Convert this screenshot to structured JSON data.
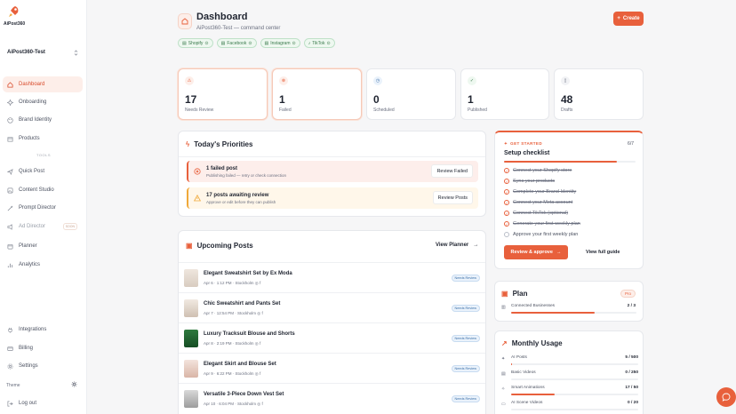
{
  "brand": {
    "logo_text": "AiPost360",
    "accent": "#e8603c"
  },
  "workspace": {
    "name": "AiPost360-Test"
  },
  "sidebar": {
    "items": [
      {
        "label": "Dashboard",
        "icon": "home-icon",
        "active": true
      },
      {
        "label": "Onboarding",
        "icon": "sparkle-icon"
      },
      {
        "label": "Brand Identity",
        "icon": "palette-icon"
      },
      {
        "label": "Products",
        "icon": "box-icon"
      }
    ],
    "tools_label": "TOOLS",
    "tools": [
      {
        "label": "Quick Post",
        "icon": "send-icon"
      },
      {
        "label": "Content Studio",
        "icon": "image-icon"
      },
      {
        "label": "Prompt Director",
        "icon": "wand-icon"
      },
      {
        "label": "Ad Director",
        "icon": "megaphone-icon",
        "badge": "SOON"
      },
      {
        "label": "Planner",
        "icon": "calendar-icon"
      },
      {
        "label": "Analytics",
        "icon": "chart-icon"
      }
    ],
    "bottom": [
      {
        "label": "Integrations",
        "icon": "plug-icon"
      },
      {
        "label": "Billing",
        "icon": "card-icon"
      },
      {
        "label": "Settings",
        "icon": "gear-icon"
      }
    ],
    "theme_label": "Theme",
    "logout_label": "Log out"
  },
  "header": {
    "title": "Dashboard",
    "subtitle": "AiPost360-Test — command center",
    "create_label": "Create",
    "tags": [
      "Shopify",
      "Facebook",
      "Instagram",
      "TikTok"
    ]
  },
  "stats": [
    {
      "value": "17",
      "label": "Needs Review"
    },
    {
      "value": "1",
      "label": "Failed"
    },
    {
      "value": "0",
      "label": "Scheduled"
    },
    {
      "value": "1",
      "label": "Published"
    },
    {
      "value": "48",
      "label": "Drafts"
    }
  ],
  "priorities": {
    "title": "Today's Priorities",
    "items": [
      {
        "title": "1 failed post",
        "subtitle": "Publishing failed — retry or check connection",
        "button": "Review Failed"
      },
      {
        "title": "17 posts awaiting review",
        "subtitle": "Approve or edit before they can publish",
        "button": "Review Posts"
      }
    ]
  },
  "upcoming": {
    "title": "Upcoming Posts",
    "view_label": "View Planner",
    "posts": [
      {
        "title": "Elegant Sweatshirt Set by Ex Moda",
        "meta": "Apr 6 · 1:12 PM · Stockholm",
        "badge": "Needs Review"
      },
      {
        "title": "Chic Sweatshirt and Pants Set",
        "meta": "Apr 7 · 12:54 PM · Stockholm",
        "badge": "Needs Review"
      },
      {
        "title": "Luxury Tracksuit Blouse and Shorts",
        "meta": "Apr 8 · 2:19 PM · Stockholm",
        "badge": "Needs Review"
      },
      {
        "title": "Elegant Skirt and Blouse Set",
        "meta": "Apr 9 · 6:22 PM · Stockholm",
        "badge": "Needs Review"
      },
      {
        "title": "Versatile 3-Piece Down Vest Set",
        "meta": "Apr 10 · 6:04 PM · Stockholm",
        "badge": "Needs Review"
      }
    ]
  },
  "checklist": {
    "eyebrow": "GET STARTED",
    "title": "Setup checklist",
    "count": "6/7",
    "progress": 0.857,
    "items": [
      {
        "label": "Connect your Shopify store",
        "done": true
      },
      {
        "label": "Sync your products",
        "done": true
      },
      {
        "label": "Complete your Brand Identity",
        "done": true
      },
      {
        "label": "Connect your Meta account",
        "done": true
      },
      {
        "label": "Connect TikTok (optional)",
        "done": true
      },
      {
        "label": "Generate your first weekly plan",
        "done": true
      },
      {
        "label": "Approve your first weekly plan",
        "done": false
      }
    ],
    "primary_button": "Review & approve",
    "secondary_button": "View full guide"
  },
  "plan": {
    "title": "Plan",
    "badge": "Pro",
    "row_label": "Connected Businesses",
    "row_value": "2 / 3",
    "row_fraction": 0.667
  },
  "usage": {
    "title": "Monthly Usage",
    "rows": [
      {
        "label": "AI Posts",
        "value": "5 / 500",
        "fraction": 0.01,
        "icon": "sparkle-icon"
      },
      {
        "label": "Basic Videos",
        "value": "0 / 250",
        "fraction": 0,
        "icon": "film-icon"
      },
      {
        "label": "Smart Animations",
        "value": "17 / 50",
        "fraction": 0.34,
        "icon": "wand-icon"
      },
      {
        "label": "AI Scene Videos",
        "value": "0 / 20",
        "fraction": 0,
        "icon": "video-icon"
      }
    ]
  }
}
